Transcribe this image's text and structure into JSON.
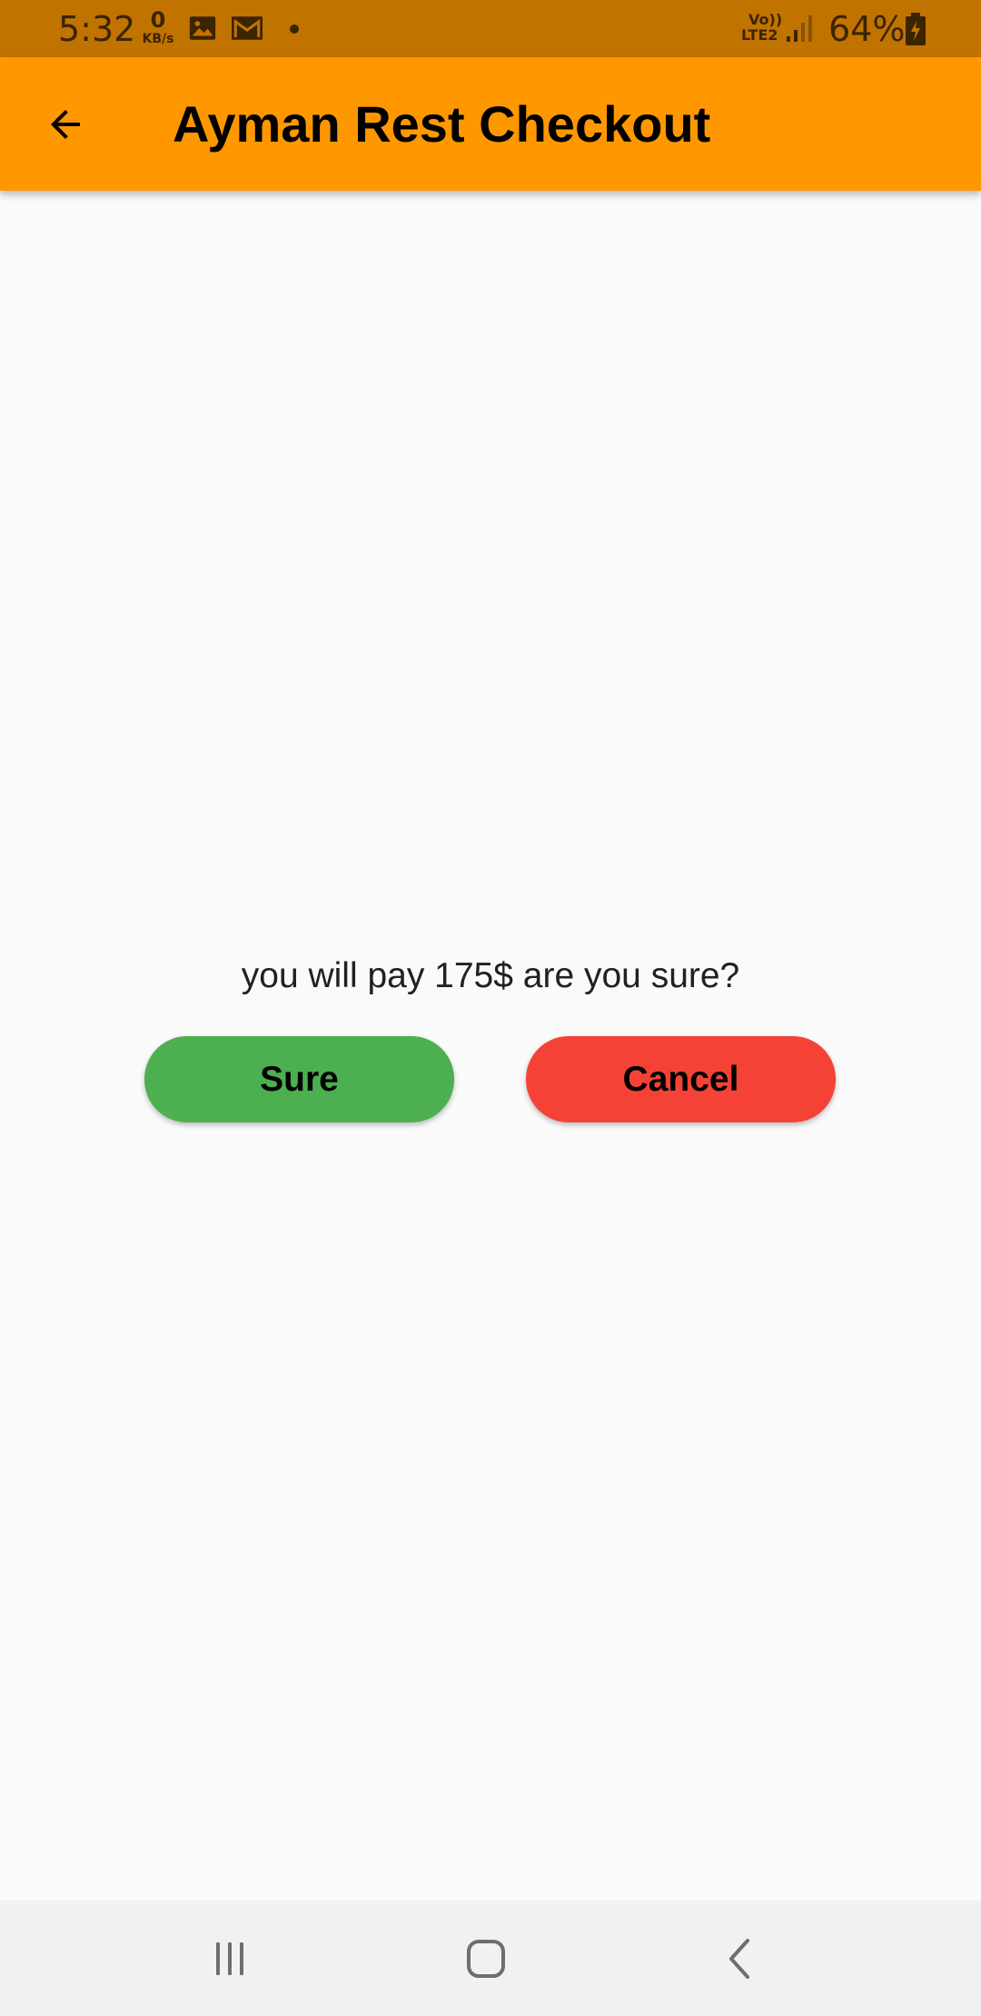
{
  "status_bar": {
    "time": "5:32",
    "net_speed_value": "0",
    "net_speed_unit": "KB/s",
    "network_label_top": "Vo))",
    "network_label_bottom": "LTE2",
    "battery": "64%",
    "icons": [
      "image-icon",
      "gmail-icon",
      "notification-dot",
      "signal-icon",
      "battery-charging-icon"
    ]
  },
  "app_bar": {
    "title": "Ayman Rest Checkout",
    "back_icon": "arrow-back-icon",
    "color": "#ff9800"
  },
  "confirm": {
    "message": "you will pay 175$ are you sure?",
    "sure_label": "Sure",
    "cancel_label": "Cancel",
    "sure_color": "#4caf50",
    "cancel_color": "#f44336"
  },
  "nav_bar": {
    "icons": [
      "recent-apps-icon",
      "home-icon",
      "back-icon"
    ]
  }
}
